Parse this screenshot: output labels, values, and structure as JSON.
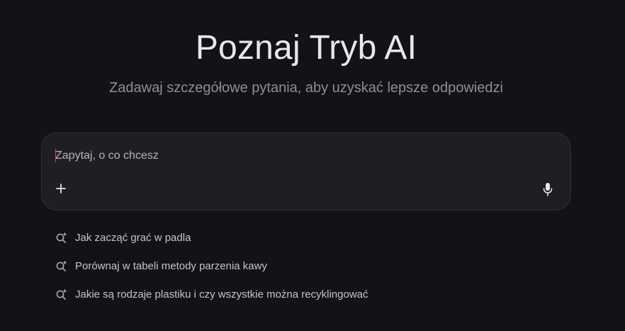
{
  "header": {
    "title": "Poznaj Tryb AI",
    "subtitle": "Zadawaj szczegółowe pytania, aby uzyskać lepsze odpowiedzi"
  },
  "ask": {
    "placeholder": "Zapytaj, o co chcesz",
    "value": "",
    "plus_icon": "plus-icon",
    "mic_icon": "microphone-icon"
  },
  "suggestions": [
    {
      "icon": "search-sparkle-icon",
      "label": "Jak zacząć grać w padla"
    },
    {
      "icon": "search-sparkle-icon",
      "label": "Porównaj w tabeli metody parzenia kawy"
    },
    {
      "icon": "search-sparkle-icon",
      "label": "Jakie są rodzaje plastiku i czy wszystkie można recyklingować"
    }
  ],
  "colors": {
    "background": "#121317",
    "box_background": "#1e1f25",
    "caret": "#e2483d"
  }
}
